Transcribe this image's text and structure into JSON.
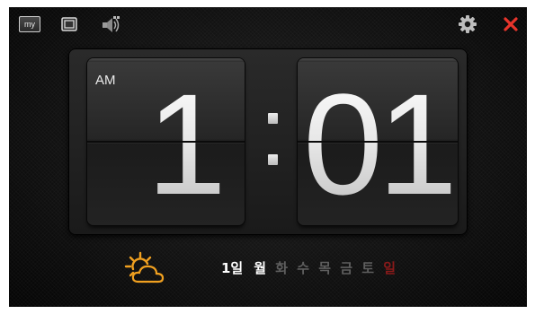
{
  "toolbar": {
    "my_label": "my",
    "icons": [
      "my-icon",
      "window-icon",
      "speaker-icon",
      "gear-icon",
      "close-icon"
    ],
    "close_color": "#e8342b"
  },
  "clock": {
    "ampm": "AM",
    "hour": "1",
    "minute": "01"
  },
  "date": {
    "day_label": "1일",
    "weekdays": [
      "월",
      "화",
      "수",
      "목",
      "금",
      "토",
      "일"
    ],
    "today_index": 0,
    "sunday_color": "#8a1a1a",
    "weather_icon": "partly-cloudy-icon",
    "weather_color": "#f0a020"
  }
}
